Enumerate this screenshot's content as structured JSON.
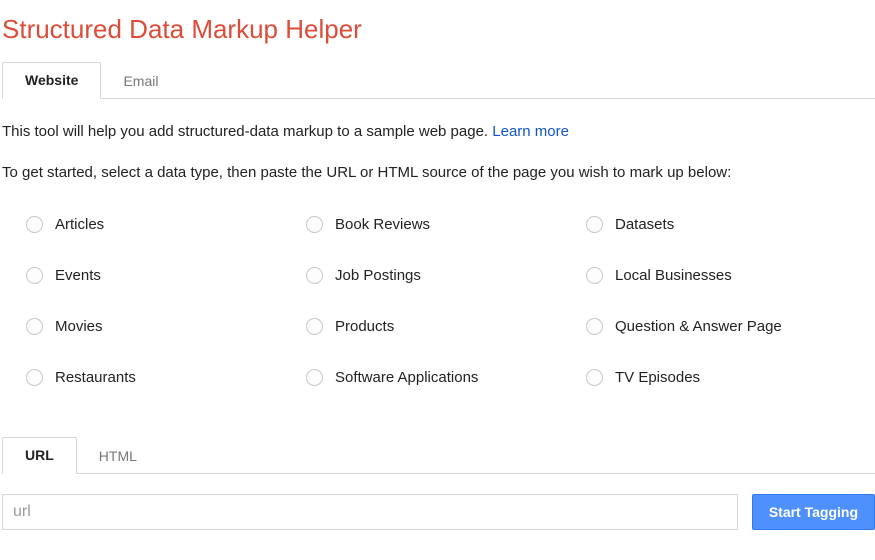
{
  "title": "Structured Data Markup Helper",
  "tabs1": {
    "website": "Website",
    "email": "Email"
  },
  "intro": {
    "line1": "This tool will help you add structured-data markup to a sample web page. ",
    "learn_more": "Learn more",
    "line2": "To get started, select a data type, then paste the URL or HTML source of the page you wish to mark up below:"
  },
  "data_types": [
    "Articles",
    "Book Reviews",
    "Datasets",
    "Events",
    "Job Postings",
    "Local Businesses",
    "Movies",
    "Products",
    "Question & Answer Page",
    "Restaurants",
    "Software Applications",
    "TV Episodes"
  ],
  "tabs2": {
    "url": "URL",
    "html": "HTML"
  },
  "url_placeholder": "url",
  "start_button": "Start Tagging"
}
